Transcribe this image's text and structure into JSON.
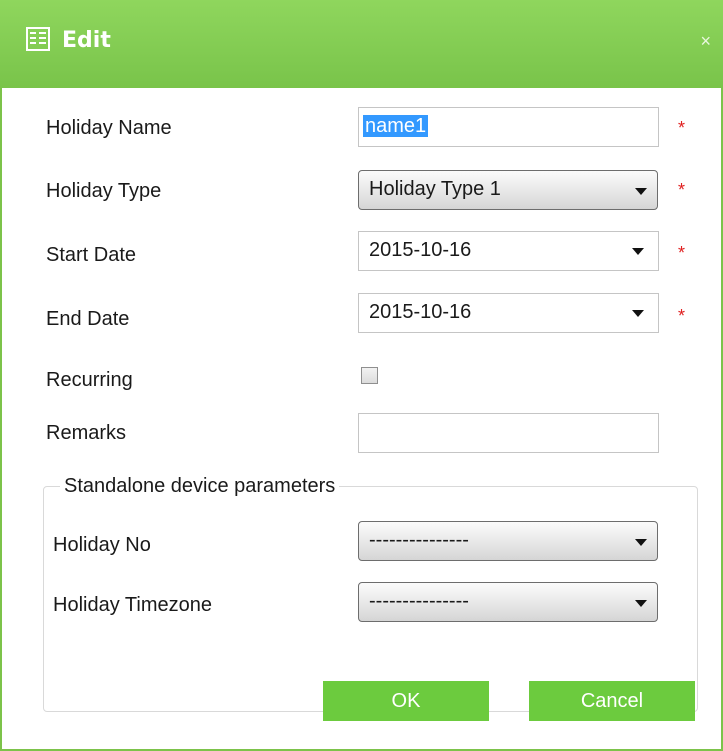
{
  "dialog": {
    "title": "Edit",
    "close_glyph": "×"
  },
  "form": {
    "holiday_name": {
      "label": "Holiday Name",
      "value": "name1",
      "required": "*"
    },
    "holiday_type": {
      "label": "Holiday Type",
      "value": "Holiday Type 1",
      "required": "*"
    },
    "start_date": {
      "label": "Start Date",
      "value": "2015-10-16",
      "required": "*"
    },
    "end_date": {
      "label": "End Date",
      "value": "2015-10-16",
      "required": "*"
    },
    "recurring": {
      "label": "Recurring",
      "checked": false
    },
    "remarks": {
      "label": "Remarks",
      "value": ""
    }
  },
  "standalone": {
    "legend": "Standalone device parameters",
    "holiday_no": {
      "label": "Holiday No",
      "value": "---------------"
    },
    "holiday_timezone": {
      "label": "Holiday Timezone",
      "value": "---------------"
    }
  },
  "buttons": {
    "ok": "OK",
    "cancel": "Cancel"
  },
  "colors": {
    "title_bar": "#79c44a",
    "button": "#6ccb3e",
    "required": "#e02020",
    "selection": "#3399ff"
  }
}
